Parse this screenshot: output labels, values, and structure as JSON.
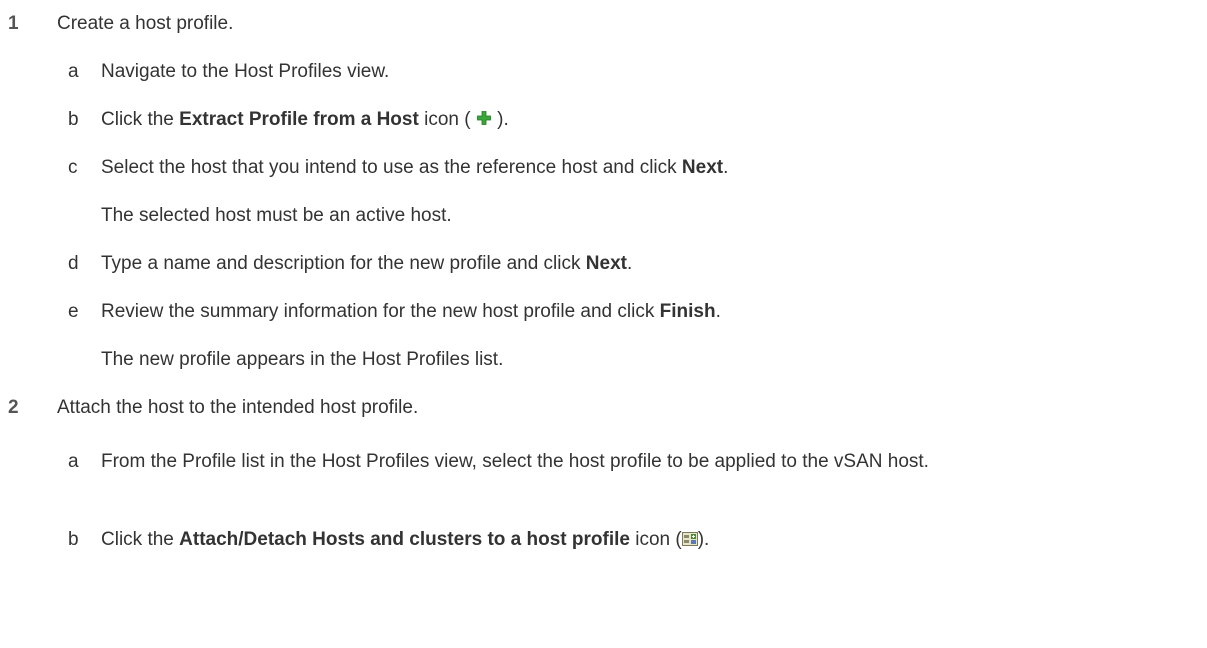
{
  "steps": [
    {
      "number": "1",
      "text": "Create a host profile.",
      "substeps": [
        {
          "letter": "a",
          "text": "Navigate to the Host Profiles view."
        },
        {
          "letter": "b",
          "before": "Click the ",
          "bold": "Extract Profile from a Host",
          "after": " icon ( ",
          "icon": "green-plus-icon",
          "end": " )."
        },
        {
          "letter": "c",
          "before": "Select the host that you intend to use as the reference host and click ",
          "bold": "Next",
          "after": ".",
          "note": "The selected host must be an active host."
        },
        {
          "letter": "d",
          "before": "Type a name and description for the new profile and click ",
          "bold": "Next",
          "after": "."
        },
        {
          "letter": "e",
          "before": "Review the summary information for the new host profile and click ",
          "bold": "Finish",
          "after": ".",
          "note": "The new profile appears in the Host Profiles list."
        }
      ]
    },
    {
      "number": "2",
      "text": "Attach the host to the intended host profile.",
      "substeps": [
        {
          "letter": "a",
          "text": "From the Profile list in the Host Profiles view, select the host profile to be applied to the vSAN host."
        },
        {
          "letter": "b",
          "before": "Click the ",
          "bold": "Attach/Detach Hosts and clusters to a host profile",
          "after": " icon (",
          "icon": "attach-detach-hosts-icon",
          "end": ")."
        }
      ]
    }
  ],
  "colors": {
    "text": "#333333",
    "step_number": "#555555",
    "plus_icon": "#3aa53a"
  }
}
